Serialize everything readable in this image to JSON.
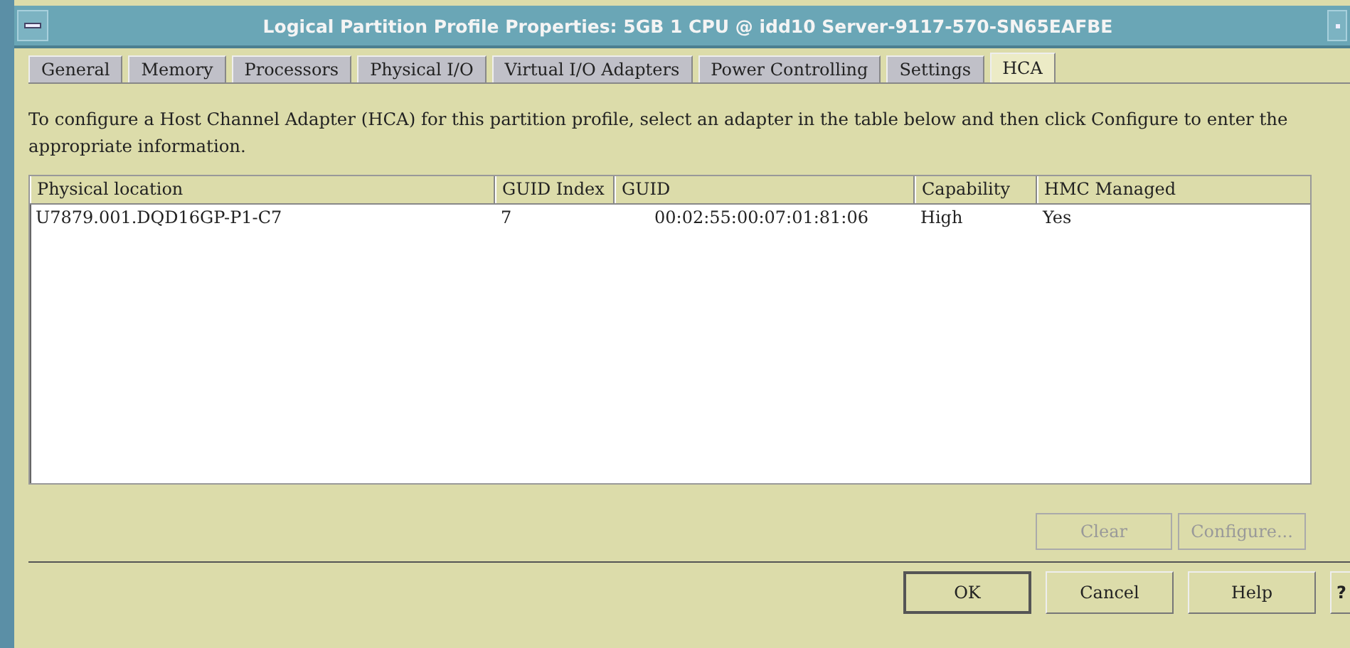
{
  "window": {
    "title": "Logical Partition Profile Properties: 5GB 1 CPU @ idd10 Server-9117-570-SN65EAFBE"
  },
  "tabs": [
    {
      "label": "General",
      "selected": false
    },
    {
      "label": "Memory",
      "selected": false
    },
    {
      "label": "Processors",
      "selected": false
    },
    {
      "label": "Physical I/O",
      "selected": false
    },
    {
      "label": "Virtual I/O Adapters",
      "selected": false
    },
    {
      "label": "Power Controlling",
      "selected": false
    },
    {
      "label": "Settings",
      "selected": false
    },
    {
      "label": "HCA",
      "selected": true
    }
  ],
  "instructions": "To configure a Host Channel Adapter (HCA) for this partition profile, select an adapter in the table below and then click Configure to enter the appropriate information.",
  "table": {
    "columns": [
      "Physical location",
      "GUID Index",
      "GUID",
      "Capability",
      "HMC Managed"
    ],
    "rows": [
      {
        "cells": [
          "U7879.001.DQD16GP-P1-C7",
          "7",
          "00:02:55:00:07:01:81:06",
          "High",
          "Yes"
        ],
        "selected": false
      }
    ]
  },
  "table_buttons": [
    {
      "label": "Clear",
      "disabled": true
    },
    {
      "label": "Configure...",
      "disabled": true
    }
  ],
  "dialog_buttons": [
    {
      "label": "OK",
      "default": true
    },
    {
      "label": "Cancel",
      "default": false
    },
    {
      "label": "Help",
      "default": false
    },
    {
      "label": "?",
      "default": false
    }
  ]
}
